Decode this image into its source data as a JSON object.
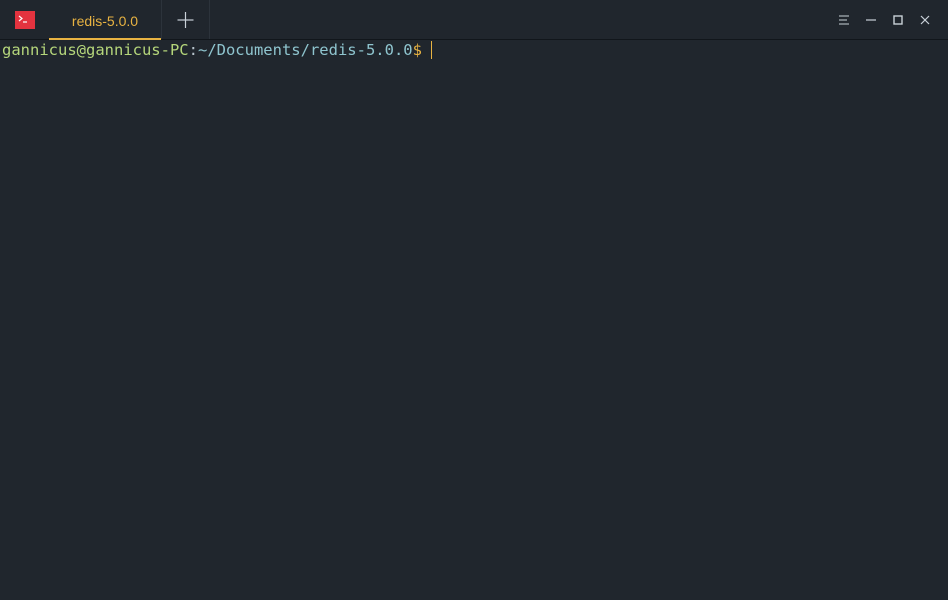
{
  "window": {
    "tab_label": "redis-5.0.0",
    "icons": {
      "app": "terminal-icon",
      "add_tab": "plus-icon",
      "menu": "menu-icon",
      "minimize": "minimize-icon",
      "maximize": "maximize-icon",
      "close": "close-icon"
    },
    "colors": {
      "background": "#20262d",
      "accent": "#e8b342",
      "app_icon": "#e4333f",
      "user_host": "#b5d67b",
      "path": "#8fc5cf"
    }
  },
  "terminal": {
    "prompt": {
      "user_host": "gannicus@gannicus-PC",
      "colon": ":",
      "path": "~/Documents/redis-5.0.0",
      "sign": "$"
    }
  }
}
